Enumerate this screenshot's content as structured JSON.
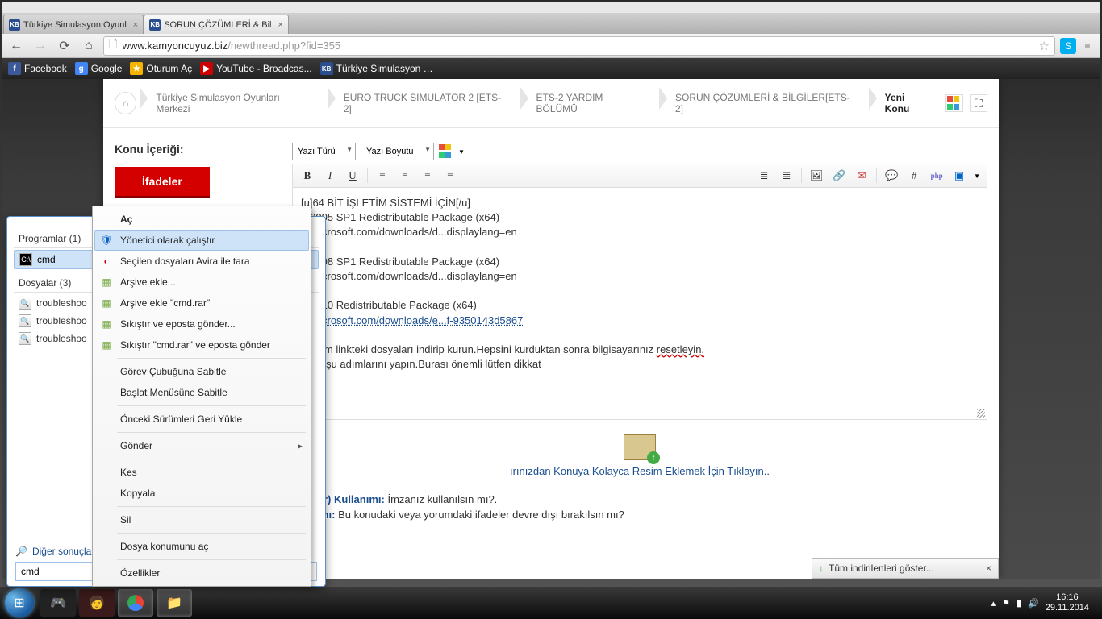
{
  "window": {
    "minimize": "—",
    "maximize": "□",
    "close": "✕"
  },
  "tabs": [
    {
      "title": "Türkiye Simulasyon Oyunl",
      "fav": "KB"
    },
    {
      "title": "SORUN ÇÖZÜMLERİ & Bil",
      "fav": "KB"
    }
  ],
  "address": {
    "domain": "www.kamyoncuyuz.biz",
    "path": "/newthread.php?fid=355"
  },
  "bookmarks": [
    {
      "label": "Facebook",
      "bg": "#3b5998",
      "t": "f"
    },
    {
      "label": "Google",
      "bg": "#4285f4",
      "t": "g"
    },
    {
      "label": "Oturum Aç",
      "bg": "#f4b400",
      "t": "★"
    },
    {
      "label": "YouTube - Broadcas...",
      "bg": "#cc0000",
      "t": "▶"
    },
    {
      "label": "Türkiye Simulasyon …",
      "bg": "#2a4d8f",
      "t": "KB"
    }
  ],
  "breadcrumb": [
    "Türkiye Simulasyon Oyunları Merkezi",
    "EURO TRUCK SIMULATOR 2 [ETS-2]",
    "ETS-2 YARDIM BÖLÜMÜ",
    "SORUN ÇÖZÜMLERİ & BİLGİLER[ETS-2]",
    "Yeni Konu"
  ],
  "subject_label": "Konu İçeriği:",
  "ifadeler": "İfadeler",
  "font_type": "Yazı Türü",
  "font_size": "Yazı Boyutu",
  "editor_lines": [
    "[u]64 BİT İŞLETİM SİSTEMİ İÇİN[/u]",
    "+ 2005 SP1 Redistributable Package (x64)",
    "w.microsoft.com/downloads/d...displaylang=en",
    "",
    "+ 2008 SP1 Redistributable Package (x64)",
    "w.microsoft.com/downloads/d...displaylang=en",
    "",
    "+ 2010 Redistributable Package (x64)"
  ],
  "editor_link_parts": [
    "w.microsoft.com/",
    "downloads/",
    "e",
    "...f-",
    "9350143d5867"
  ],
  "editor_tail": [
    "duğum linkteki dosyaları indirip kurun.Hepsini kurduktan sonra bilgisayarınız ",
    "resetleyin.",
    "a ise şu adımlarını yapın.Burası önemli lütfen dikkat"
  ],
  "pic_link": "ırınızdan Konuya Kolayca Resim Eklemek İçin Tıklayın..",
  "sig": {
    "a_b": "ignatür) Kullanımı:",
    "a_t": " İmzanız kullanılsın mı?.",
    "b_b": "ullanımı:",
    "b_t": " Bu konudaki veya yorumdaki ifadeler devre dışı bırakılsın mı?"
  },
  "download_bar": "Tüm indirilenleri göster...",
  "start": {
    "programs_hdr": "Programlar (1)",
    "prog_item": "cmd",
    "files_hdr": "Dosyalar (3)",
    "files": [
      "troubleshoo",
      "troubleshoo",
      "troubleshoo"
    ],
    "more": "Diğer sonuçları",
    "search_value": "cmd"
  },
  "ctx": {
    "open": "Aç",
    "admin": "Yönetici olarak çalıştır",
    "avira": "Seçilen dosyaları Avira ile tara",
    "arch1": "Arşive ekle...",
    "arch2": "Arşive ekle \"cmd.rar\"",
    "zip1": "Sıkıştır ve eposta gönder...",
    "zip2": "Sıkıştır \"cmd.rar\" ve eposta gönder",
    "pin_tb": "Görev Çubuğuna Sabitle",
    "pin_sm": "Başlat Menüsüne Sabitle",
    "prev": "Önceki Sürümleri Geri Yükle",
    "send": "Gönder",
    "cut": "Kes",
    "copy": "Kopyala",
    "del": "Sil",
    "loc": "Dosya konumunu aç",
    "prop": "Özellikler"
  },
  "tray": {
    "time": "16:16",
    "date": "29.11.2014"
  }
}
